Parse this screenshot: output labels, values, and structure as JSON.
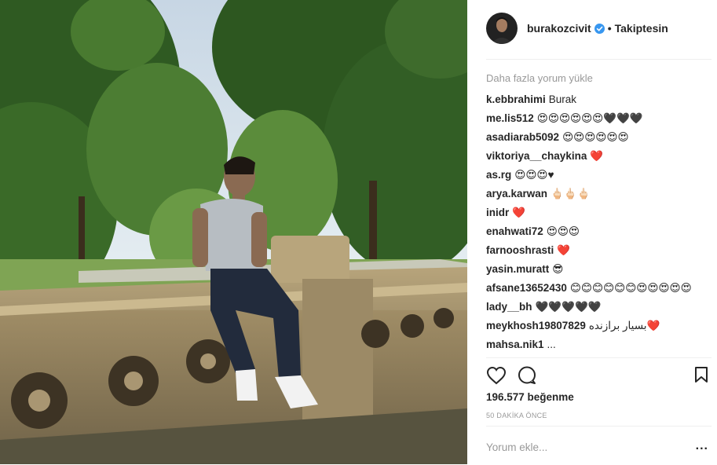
{
  "post": {
    "username": "burakozcivit",
    "separator": "•",
    "follow_status": "Takiptesin",
    "load_more": "Daha fazla yorum yükle",
    "likes": "196.577 beğenme",
    "time": "50 DAKİKA ÖNCE",
    "add_comment_placeholder": "Yorum ekle...",
    "more_options": "..."
  },
  "comments": [
    {
      "user": "k.ebbrahimi",
      "text": "Burak"
    },
    {
      "user": "me.lis512",
      "text": "😍😍😍😍😍😍🖤🖤🖤"
    },
    {
      "user": "asadiarab5092",
      "text": "😍😍😍😍😍😍"
    },
    {
      "user": "viktoriya__chaykina",
      "text": "❤️"
    },
    {
      "user": "as.rg",
      "text": "😍😍😍♥"
    },
    {
      "user": "arya.karwan",
      "text": "🖕🏻🖕🏻🖕🏻"
    },
    {
      "user": "inidr",
      "text": "❤️"
    },
    {
      "user": "enahwati72",
      "text": "😍😍😍"
    },
    {
      "user": "farnooshrasti",
      "text": "❤️"
    },
    {
      "user": "yasin.muratt",
      "text": "😎"
    },
    {
      "user": "afsane13652430",
      "text": "😊😊😊😊😊😊😍😍😍😍😍"
    },
    {
      "user": "lady__bh",
      "text": "🖤🖤🖤🖤🖤"
    },
    {
      "user": "meykhosh19807829",
      "text": "بسیار برازنده❤️"
    },
    {
      "user": "mahsa.nik1",
      "text": "..."
    }
  ],
  "icons": {
    "verified": "verified-badge-icon",
    "like": "heart-icon",
    "comment": "comment-icon",
    "save": "bookmark-icon"
  },
  "colors": {
    "verified_blue": "#3897f0",
    "text": "#262626",
    "muted": "#999999"
  }
}
